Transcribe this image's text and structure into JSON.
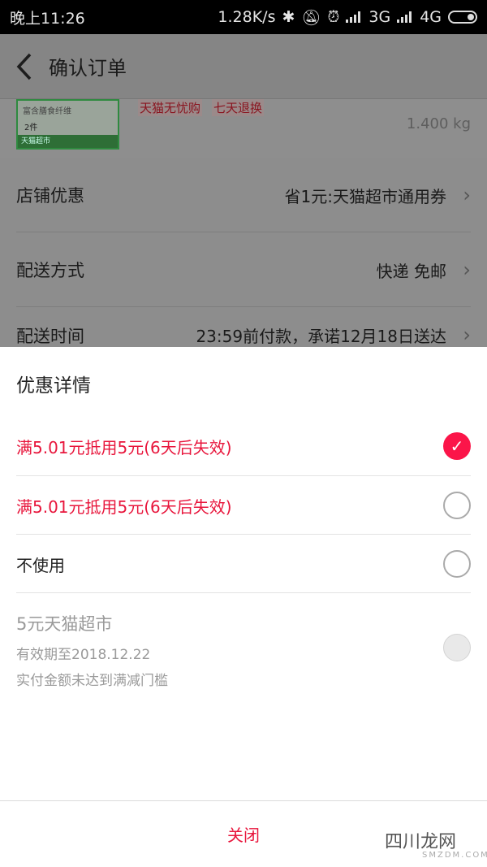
{
  "status_bar": {
    "time": "晚上11:26",
    "net_speed": "1.28K/s",
    "net1": "3G",
    "net2": "4G"
  },
  "header": {
    "title": "确认订单"
  },
  "product": {
    "thumb_top_text": "富含膳食纤维",
    "thumb_qty": "2件",
    "thumb_band": "天猫超市",
    "tags": [
      "天猫无忧购",
      "七天退换"
    ],
    "weight": "1.400 kg"
  },
  "rows": [
    {
      "label": "店铺优惠",
      "value": "省1元:天猫超市通用券"
    },
    {
      "label": "配送方式",
      "value": "快递 免邮"
    },
    {
      "label": "配送时间",
      "value": "23:59前付款，承诺12月18日送达"
    }
  ],
  "sheet": {
    "title": "优惠详情",
    "options": [
      {
        "label": "满5.01元抵用5元(6天后失效)",
        "state": "checked"
      },
      {
        "label": "满5.01元抵用5元(6天后失效)",
        "state": "unchecked"
      },
      {
        "label": "不使用",
        "state": "unchecked"
      }
    ],
    "unavailable": {
      "title": "5元天猫超市",
      "expiry": "有效期至2018.12.22",
      "note": "实付金额未达到满减门槛"
    },
    "close_label": "关闭"
  },
  "watermark": {
    "text": "四川龙网",
    "sub": "SMZDM.COM"
  },
  "colors": {
    "accent": "#e8163c",
    "check": "#fb1549",
    "overlay": "#8c8c8c"
  }
}
